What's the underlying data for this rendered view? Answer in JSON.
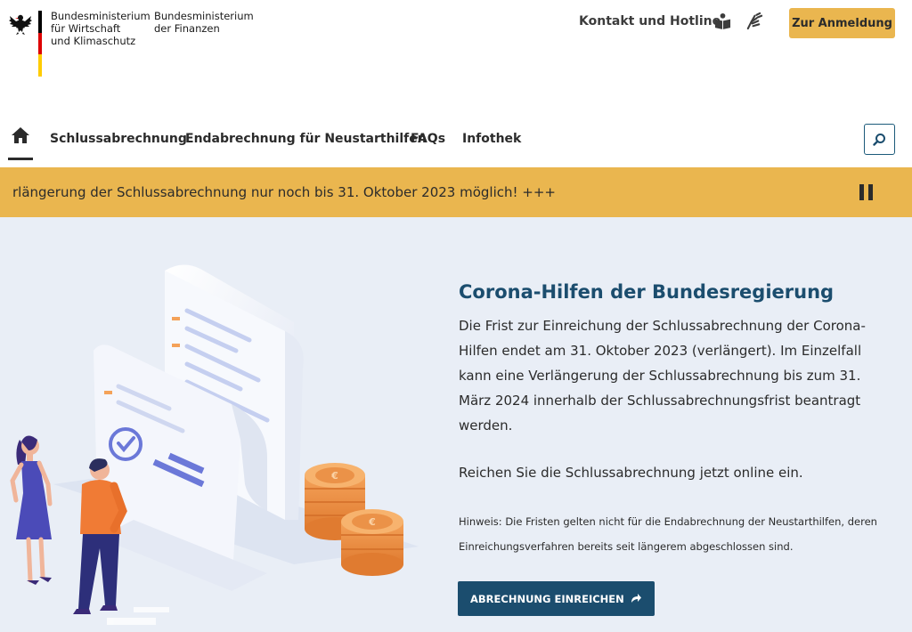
{
  "header": {
    "ministry_1": "Bundesministerium\nfür Wirtschaft\nund Klimaschutz",
    "ministry_2": "Bundesministerium\nder Finanzen",
    "contact_label": "Kontakt und Hotline",
    "login_label": "Zur Anmeldung",
    "icons": [
      "eagle-icon",
      "easy-language-book-icon",
      "sign-language-hands-icon"
    ]
  },
  "nav": {
    "items": [
      {
        "label": "Schlussabrechnung"
      },
      {
        "label": "Endabrechnung für Neustarthilfen"
      },
      {
        "label": "FAQs"
      },
      {
        "label": "Infothek"
      }
    ],
    "icons": [
      "home-icon",
      "search-icon"
    ]
  },
  "ticker": {
    "text": "rlängerung der Schlussabrechnung nur noch bis 31. Oktober 2023 möglich! +++",
    "icon": "pause-icon"
  },
  "hero": {
    "title": "Corona-Hilfen der Bundesregierung",
    "paragraph": "Die Frist zur Einreichung der Schlussabrechnung der Corona-Hilfen endet am 31. Oktober 2023 (verlängert). Im Einzelfall kann eine Verlängerung der Schlussabrechnung bis zum 31. März 2024 innerhalb der Schlussabrechnungsfrist beantragt werden.",
    "cta_text": "Reichen Sie die Schlussabrechnung jetzt online ein.",
    "note": "Hinweis: Die Fristen gelten nicht für die Endabrechnung der Neustarthilfen, deren Einreichungsverfahren bereits seit längerem abgeschlossen sind.",
    "button_label": "ABRECHNUNG EINREICHEN"
  },
  "colors": {
    "accent_yellow": "#eab64f",
    "primary_blue": "#1b4d6e",
    "hero_bg": "#e9eef6",
    "flag_black": "#000000",
    "flag_red": "#dd0000",
    "flag_gold": "#ffcc00"
  }
}
